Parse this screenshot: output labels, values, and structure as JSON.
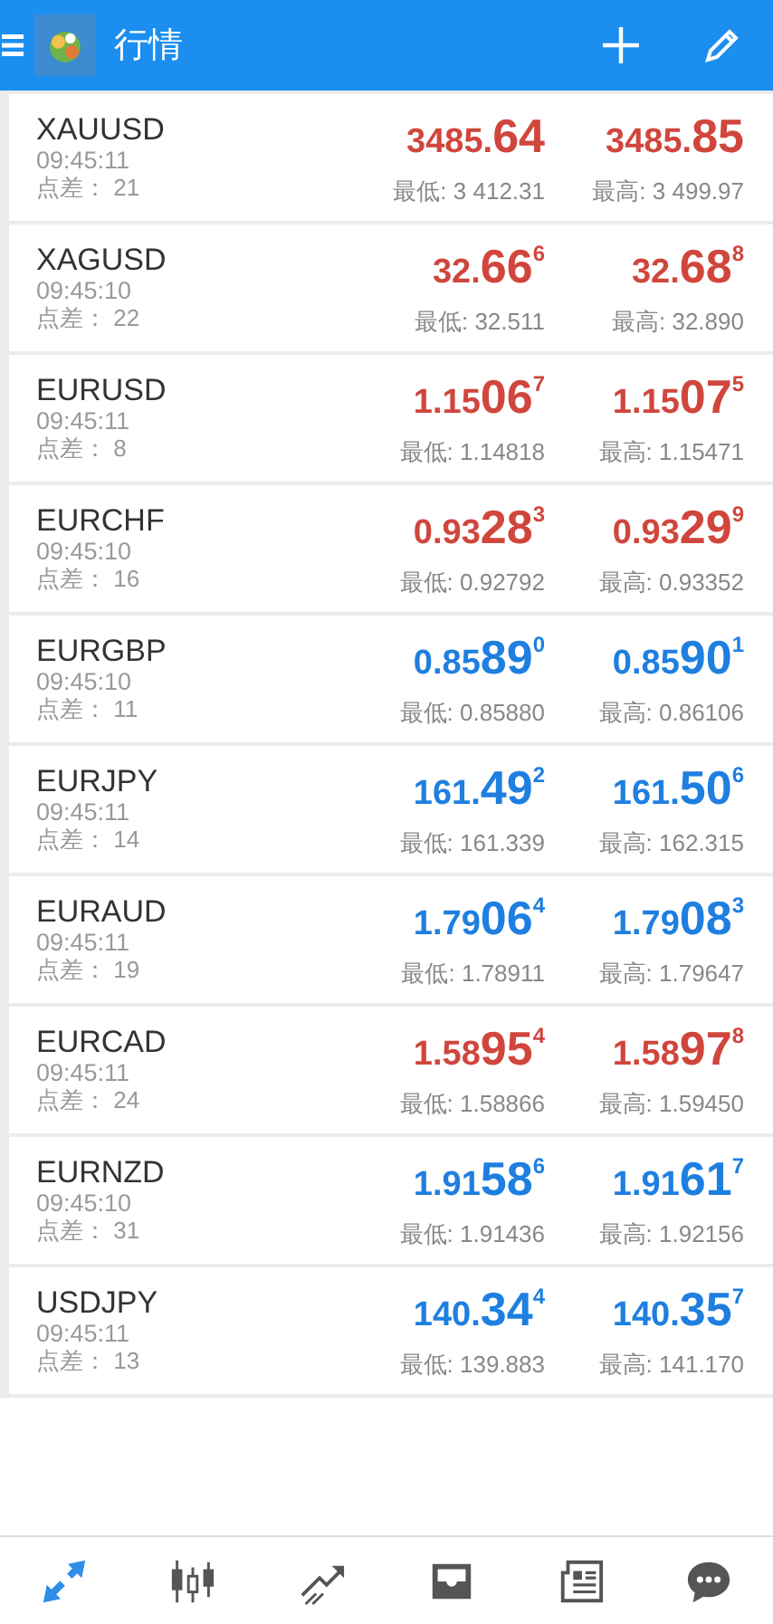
{
  "header": {
    "title": "行情"
  },
  "quotes": [
    {
      "symbol": "XAUUSD",
      "time": "09:45:11",
      "spread": "点差： 21",
      "color": "#d0463d",
      "bid": {
        "prefix": "3485.",
        "big": "64"
      },
      "ask": {
        "prefix": "3485.",
        "big": "85"
      },
      "low": "最低: 3 412.31",
      "high": "最高: 3 499.97"
    },
    {
      "symbol": "XAGUSD",
      "time": "09:45:10",
      "spread": "点差： 22",
      "color": "#d0463d",
      "bid": {
        "prefix": "32.",
        "big": "66",
        "sup": "6"
      },
      "ask": {
        "prefix": "32.",
        "big": "68",
        "sup": "8"
      },
      "low": "最低: 32.511",
      "high": "最高: 32.890"
    },
    {
      "symbol": "EURUSD",
      "time": "09:45:11",
      "spread": "点差： 8",
      "color": "#d0463d",
      "bid": {
        "prefix": "1.15",
        "big": "06",
        "sup": "7"
      },
      "ask": {
        "prefix": "1.15",
        "big": "07",
        "sup": "5"
      },
      "low": "最低: 1.14818",
      "high": "最高: 1.15471"
    },
    {
      "symbol": "EURCHF",
      "time": "09:45:10",
      "spread": "点差： 16",
      "color": "#d0463d",
      "bid": {
        "prefix": "0.93",
        "big": "28",
        "sup": "3"
      },
      "ask": {
        "prefix": "0.93",
        "big": "29",
        "sup": "9"
      },
      "low": "最低: 0.92792",
      "high": "最高: 0.93352"
    },
    {
      "symbol": "EURGBP",
      "time": "09:45:10",
      "spread": "点差： 11",
      "color": "#1e7fe0",
      "bid": {
        "prefix": "0.85",
        "big": "89",
        "sup": "0"
      },
      "ask": {
        "prefix": "0.85",
        "big": "90",
        "sup": "1"
      },
      "low": "最低: 0.85880",
      "high": "最高: 0.86106"
    },
    {
      "symbol": "EURJPY",
      "time": "09:45:11",
      "spread": "点差： 14",
      "color": "#1e7fe0",
      "bid": {
        "prefix": "161.",
        "big": "49",
        "sup": "2"
      },
      "ask": {
        "prefix": "161.",
        "big": "50",
        "sup": "6"
      },
      "low": "最低: 161.339",
      "high": "最高: 162.315"
    },
    {
      "symbol": "EURAUD",
      "time": "09:45:11",
      "spread": "点差： 19",
      "color": "#1e7fe0",
      "bid": {
        "prefix": "1.79",
        "big": "06",
        "sup": "4"
      },
      "ask": {
        "prefix": "1.79",
        "big": "08",
        "sup": "3"
      },
      "low": "最低: 1.78911",
      "high": "最高: 1.79647"
    },
    {
      "symbol": "EURCAD",
      "time": "09:45:11",
      "spread": "点差： 24",
      "color": "#d0463d",
      "bid": {
        "prefix": "1.58",
        "big": "95",
        "sup": "4"
      },
      "ask": {
        "prefix": "1.58",
        "big": "97",
        "sup": "8"
      },
      "low": "最低: 1.58866",
      "high": "最高: 1.59450"
    },
    {
      "symbol": "EURNZD",
      "time": "09:45:10",
      "spread": "点差： 31",
      "color": "#1e7fe0",
      "bid": {
        "prefix": "1.91",
        "big": "58",
        "sup": "6"
      },
      "ask": {
        "prefix": "1.91",
        "big": "61",
        "sup": "7"
      },
      "low": "最低: 1.91436",
      "high": "最高: 1.92156"
    },
    {
      "symbol": "USDJPY",
      "time": "09:45:11",
      "spread": "点差： 13",
      "color": "#1e7fe0",
      "bid": {
        "prefix": "140.",
        "big": "34",
        "sup": "4"
      },
      "ask": {
        "prefix": "140.",
        "big": "35",
        "sup": "7"
      },
      "low": "最低: 139.883",
      "high": "最高: 141.170"
    }
  ],
  "nav": [
    {
      "kind": "quotes",
      "selected": true
    },
    {
      "kind": "chart",
      "selected": false
    },
    {
      "kind": "trade",
      "selected": false
    },
    {
      "kind": "inbox",
      "selected": false
    },
    {
      "kind": "news",
      "selected": false
    },
    {
      "kind": "chat",
      "selected": false
    }
  ]
}
